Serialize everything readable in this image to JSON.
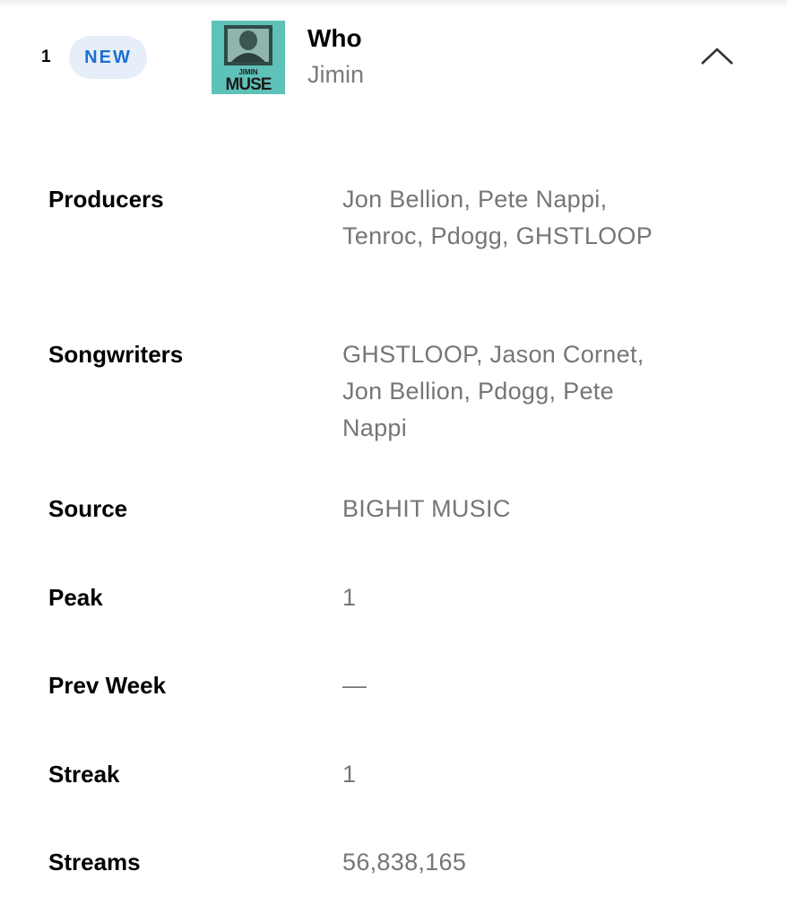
{
  "entry": {
    "rank": "1",
    "badge": "NEW",
    "cover": {
      "icon": "album-cover-muse",
      "text_top": "JIMIN",
      "text_bottom": "MUSE",
      "bg_color": "#5fc2b8"
    },
    "title": "Who",
    "artist": "Jimin",
    "collapse_icon": "chevron-up-icon"
  },
  "details": [
    {
      "key": "producers",
      "label": "Producers",
      "value": "Jon Bellion, Pete Nappi, Tenroc, Pdogg, GHSTLOOP"
    },
    {
      "key": "songwriters",
      "label": "Songwriters",
      "value": "GHSTLOOP, Jason Cornet, Jon Bellion, Pdogg, Pete Nappi"
    },
    {
      "key": "source",
      "label": "Source",
      "value": "BIGHIT MUSIC"
    },
    {
      "key": "peak",
      "label": "Peak",
      "value": "1"
    },
    {
      "key": "prev-week",
      "label": "Prev Week",
      "value": "—"
    },
    {
      "key": "streak",
      "label": "Streak",
      "value": "1"
    },
    {
      "key": "streams",
      "label": "Streams",
      "value": "56,838,165"
    }
  ],
  "colors": {
    "accent": "#1c6fd1",
    "badge_bg": "#e6eef9",
    "secondary_text": "#767676"
  }
}
